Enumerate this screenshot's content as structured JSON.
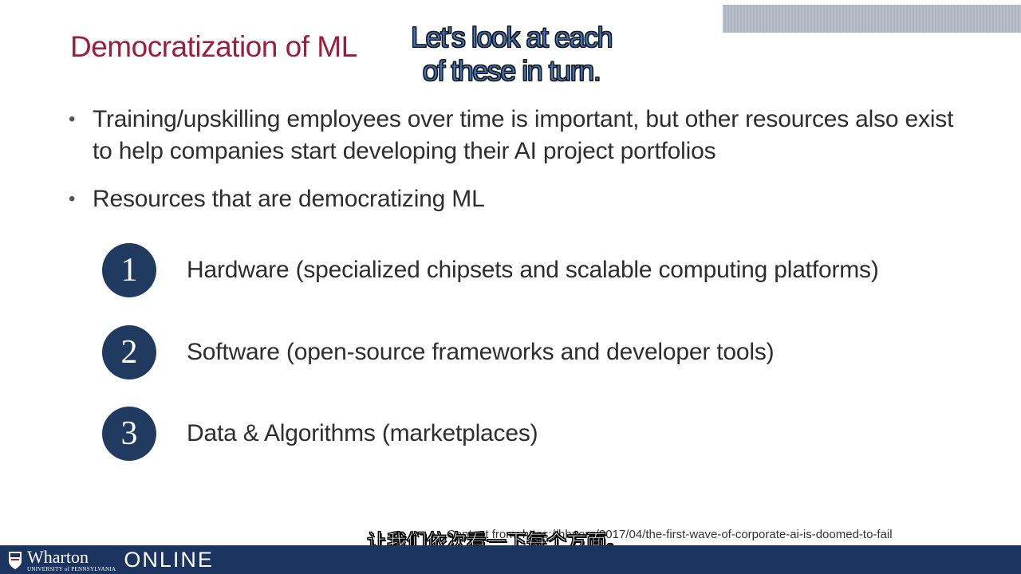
{
  "slide": {
    "title": "Democratization of ML",
    "callout_line1": "Let's look at each",
    "callout_line2": "of these in turn.",
    "bullets": [
      "Training/upskilling employees over time is important, but other resources also exist to help companies start developing their AI project portfolios",
      "Resources that are democratizing ML"
    ],
    "resources": [
      {
        "number": "1",
        "label": "Hardware (specialized chipsets and scalable computing platforms)"
      },
      {
        "number": "2",
        "label": "Software (open-source frameworks and developer tools)"
      },
      {
        "number": "3",
        "label": "Data & Algorithms (marketplaces)"
      }
    ],
    "source_text": "Content from: https://hbr.org/2017/04/the-first-wave-of-corporate-ai-is-doomed-to-fail"
  },
  "subtitle": "让我们依次看一下每个方面。",
  "footer": {
    "logo_name": "Wharton",
    "logo_sub": "UNIVERSITY of PENNSYLVANIA",
    "logo_online": "ONLINE"
  },
  "colors": {
    "title": "#9b1f3c",
    "callout": "#3a76c2",
    "circle": "#213a5f",
    "footer": "#1c3460",
    "top_bar": "#b5bcc7"
  }
}
